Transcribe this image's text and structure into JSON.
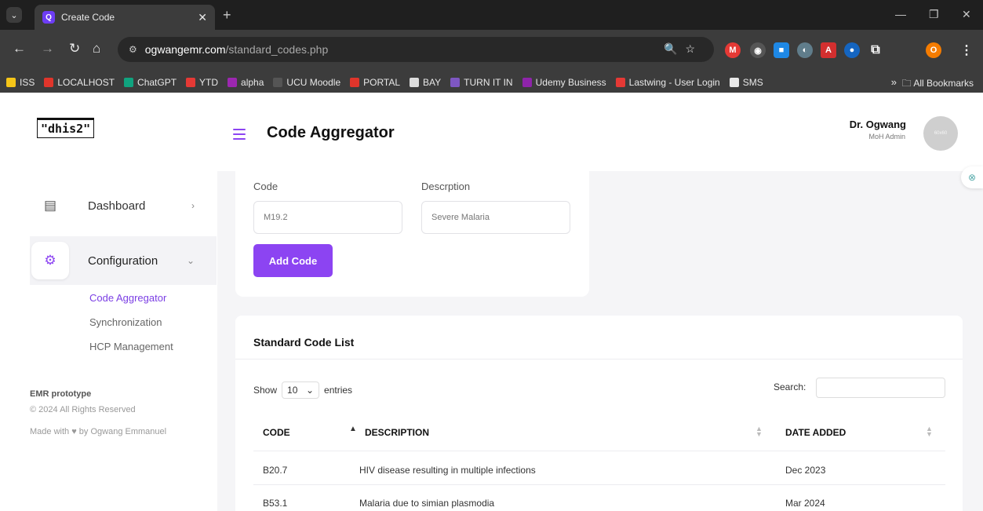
{
  "browser": {
    "tab_title": "Create Code",
    "tab_favicon": "Q",
    "url_domain": "ogwangemr.com",
    "url_path": "/standard_codes.php",
    "profile_initial": "O",
    "bookmarks": [
      {
        "label": "ISS",
        "icon": "iss-icon",
        "color": "#f5c518"
      },
      {
        "label": "LOCALHOST",
        "icon": "opera-icon",
        "color": "#e0352b"
      },
      {
        "label": "ChatGPT",
        "icon": "chatgpt-icon",
        "color": "#10a37f"
      },
      {
        "label": "YTD",
        "icon": "download-icon",
        "color": "#e53935"
      },
      {
        "label": "alpha",
        "icon": "atom-icon",
        "color": "#9c27b0"
      },
      {
        "label": "UCU Moodle",
        "icon": "moodle-icon",
        "color": "#555555"
      },
      {
        "label": "PORTAL",
        "icon": "opera-icon",
        "color": "#e0352b"
      },
      {
        "label": "BAY",
        "icon": "monitor-icon",
        "color": "#dddddd"
      },
      {
        "label": "TURN IT IN",
        "icon": "turnitin-icon",
        "color": "#7e57c2"
      },
      {
        "label": "Udemy Business",
        "icon": "udemy-icon",
        "color": "#8e24aa"
      },
      {
        "label": "Lastwing - User Login",
        "icon": "dash-icon",
        "color": "#e53935"
      },
      {
        "label": "SMS",
        "icon": "sms-icon",
        "color": "#e8e8e8"
      }
    ],
    "bookmarks_more": "»",
    "all_bookmarks": "All Bookmarks"
  },
  "app": {
    "logo": "\"dhis2\"",
    "page_title": "Code Aggregator",
    "user_name": "Dr. Ogwang",
    "user_role": "MoH Admin",
    "avatar_text": "60x60"
  },
  "sidebar": {
    "items": [
      {
        "label": "Dashboard",
        "icon": "dashboard-icon",
        "caret": "›"
      },
      {
        "label": "Configuration",
        "icon": "gear-icon",
        "caret": "⌄"
      }
    ],
    "subitems": [
      {
        "label": "Code Aggregator",
        "active": true
      },
      {
        "label": "Synchronization",
        "active": false
      },
      {
        "label": "HCP Management",
        "active": false
      }
    ],
    "footer": {
      "title": "EMR prototype",
      "copyright": "© 2024 All Rights Reserved",
      "made_prefix": "Made with",
      "made_suffix": "by Ogwang Emmanuel"
    }
  },
  "form": {
    "code_label": "Code",
    "code_placeholder": "M19.2",
    "desc_label": "Descrption",
    "desc_placeholder": "Severe Malaria",
    "add_button": "Add Code"
  },
  "table": {
    "title": "Standard Code List",
    "show_label": "Show",
    "entries_value": "10",
    "entries_label": "entries",
    "search_label": "Search:",
    "headers": [
      "CODE",
      "DESCRIPTION",
      "DATE ADDED"
    ],
    "rows": [
      {
        "code": "B20.7",
        "description": "HIV disease resulting in multiple infections",
        "date": "Dec 2023"
      },
      {
        "code": "B53.1",
        "description": "Malaria due to simian plasmodia",
        "date": "Mar 2024"
      }
    ]
  },
  "colors": {
    "accent": "#8c44f2",
    "active_link": "#7b3fe4"
  }
}
